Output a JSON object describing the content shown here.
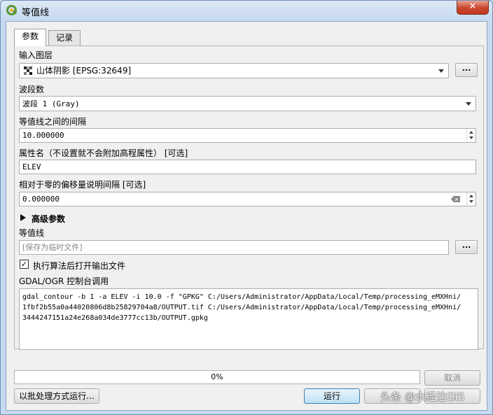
{
  "window": {
    "title": "等值线",
    "close_label": "✕"
  },
  "tabs": [
    {
      "label": "参数"
    },
    {
      "label": "记录"
    }
  ],
  "params": {
    "input_layer": {
      "label": "输入图层",
      "value": "山体阴影 [EPSG:32649]",
      "browse": "..."
    },
    "band": {
      "label": "波段数",
      "value": "波段 1 (Gray)"
    },
    "interval": {
      "label": "等值线之间的间隔",
      "value": "10.000000"
    },
    "attribute": {
      "label": "属性名（不设置就不会附加高程属性） [可选]",
      "value": "ELEV"
    },
    "offset": {
      "label": "相对于零的偏移量说明间隔 [可选]",
      "value": "0.000000"
    },
    "advanced": {
      "label": "高级参数"
    },
    "output": {
      "label": "等值线",
      "placeholder": "[保存为临时文件]",
      "browse": "..."
    },
    "open_after": {
      "label": "执行算法后打开输出文件",
      "checked": true
    },
    "console": {
      "label": "GDAL/OGR 控制台调用",
      "lines": [
        "gdal_contour -b 1 -a ELEV -i 10.0 -f \"GPKG\" C:/Users/Administrator/AppData/Local/Temp/processing_eMXHni/",
        "1fbf2b55a0a44020806d8b25829704a8/OUTPUT.tif C:/Users/Administrator/AppData/Local/Temp/processing_eMXHni/",
        "3444247151a24e268a034de3777cc13b/OUTPUT.gpkg"
      ]
    }
  },
  "footer": {
    "progress": {
      "value": 0,
      "text": "0%"
    },
    "cancel": "取消",
    "batch": "以批处理方式运行...",
    "run": "运行"
  },
  "watermark": "头条 @水经注GIS",
  "icons": {
    "app": "qgis-logo-icon",
    "layer": "raster-layer-icon",
    "advanced": "triangle-right-icon"
  },
  "colors": {
    "accent": "#3c7fb1",
    "close": "#c9452c",
    "qgis_green": "#589632"
  }
}
